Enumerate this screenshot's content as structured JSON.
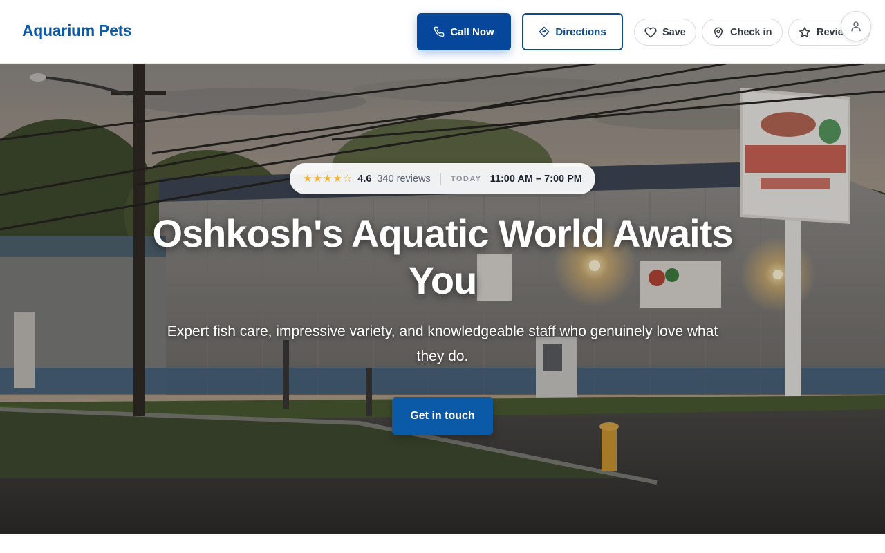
{
  "brand": {
    "name": "Aquarium Pets",
    "color": "#0b5aa8"
  },
  "header": {
    "call_label": "Call Now",
    "directions_label": "Directions",
    "save_label": "Save",
    "checkin_label": "Check in",
    "review_label": "Review",
    "icons": [
      "phone-icon",
      "directions-icon",
      "heart-icon",
      "map-pin-icon",
      "star-icon",
      "user-icon"
    ]
  },
  "hero": {
    "rating": "4.6",
    "rating_value": 4.6,
    "reviews": "340 reviews",
    "today_label": "TODAY",
    "hours": "11:00 AM – 7:00 PM",
    "headline": "Oshkosh's Aquatic World Awaits You",
    "subheadline": "Expert fish care, impressive variety, and knowledgeable staff who genuinely love what they do.",
    "cta_label": "Get in touch"
  },
  "colors": {
    "primary": "#06479b",
    "accent_star": "#f1b12f"
  }
}
